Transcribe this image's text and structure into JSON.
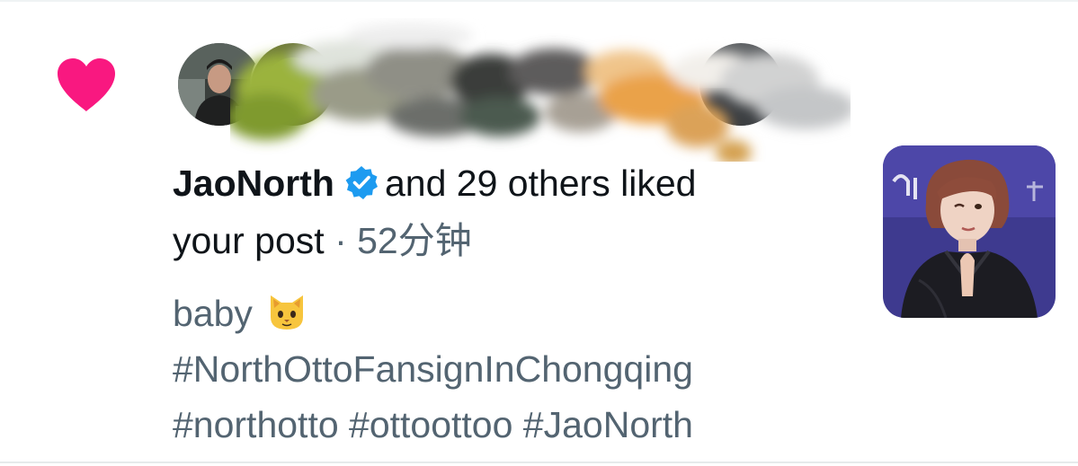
{
  "notification": {
    "type_icon": "heart-icon",
    "colors": {
      "heart": "#f91880",
      "verified": "#1d9bf0",
      "primary_text": "#0f1419",
      "secondary_text": "#536471"
    },
    "actor": {
      "username": "JaoNorth",
      "verified": true,
      "verified_icon": "verified-badge-icon"
    },
    "action_text": "and 29 others liked",
    "action_text_cont": "your post",
    "separator": "·",
    "time": "52分钟",
    "post": {
      "line1": "baby",
      "emoji": "cat-face-emoji",
      "line2": "#NorthOttoFansignInChongqing",
      "line3": "#northotto #ottoottoo #JaoNorth"
    },
    "thumbnail": {
      "icon": "post-photo-thumbnail"
    }
  }
}
